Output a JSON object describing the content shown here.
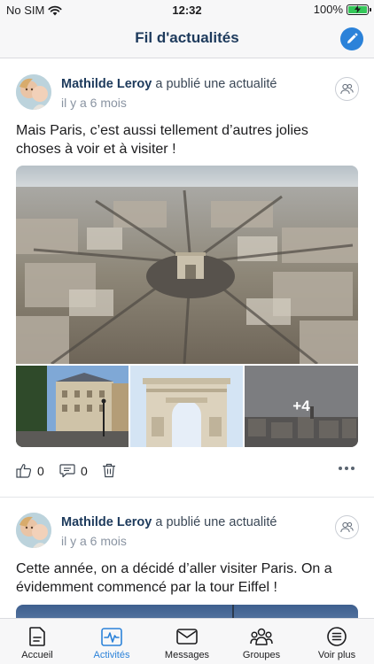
{
  "status_bar": {
    "carrier": "No SIM",
    "time": "12:32",
    "battery": "100%",
    "battery_level": 1.0
  },
  "header": {
    "title": "Fil d'actualités",
    "compose_icon": "pencil-icon"
  },
  "posts": [
    {
      "author": "Mathilde Leroy",
      "action": " a publié une actualité",
      "time": "il y a 6 mois",
      "text": "Mais Paris, c’est aussi tellement d’autres jolies choses à voir et à visiter !",
      "more_photos": "+4",
      "likes": "0",
      "comments": "0"
    },
    {
      "author": "Mathilde Leroy",
      "action": " a publié une actualité",
      "time": "il y a 6 mois",
      "text": "Cette année, on a décidé d’aller visiter Paris. On a évidemment commencé par la tour Eiffel !"
    }
  ],
  "tabs": [
    {
      "label": "Accueil",
      "icon": "document-icon",
      "active": false
    },
    {
      "label": "Activités",
      "icon": "activity-icon",
      "active": true
    },
    {
      "label": "Messages",
      "icon": "envelope-icon",
      "active": false
    },
    {
      "label": "Groupes",
      "icon": "group-icon",
      "active": false
    },
    {
      "label": "Voir plus",
      "icon": "list-icon",
      "active": false
    }
  ],
  "colors": {
    "accent": "#2b82d9",
    "title": "#1d3a5c",
    "battery": "#34c759"
  }
}
